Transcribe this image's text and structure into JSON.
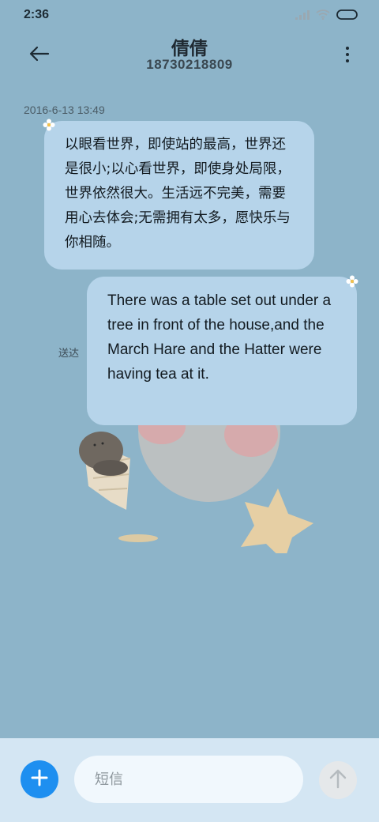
{
  "status_bar": {
    "time": "2:36",
    "icons": [
      "signal-icon",
      "wifi-icon",
      "battery-icon"
    ]
  },
  "header": {
    "contact_name": "倩倩",
    "contact_number": "18730218809",
    "back_icon": "arrow-left-icon",
    "more_icon": "more-vertical-icon"
  },
  "conversation": {
    "timestamp": "2016-6-13 13:49",
    "messages": [
      {
        "direction": "incoming",
        "text": "以眼看世界，即使站的最高，世界还是很小;以心看世界，即使身处局限，世界依然很大。生活远不完美，需要用心去体会;无需拥有太多，愿快乐与你相随。"
      },
      {
        "direction": "outgoing",
        "text": "There was a table set out under a tree in front of the house,and the March Hare and the Hatter were having tea at it."
      }
    ],
    "delivery_status": "送达"
  },
  "input_bar": {
    "placeholder": "短信",
    "value": "",
    "add_icon": "plus-icon",
    "send_icon": "arrow-up-icon"
  },
  "colors": {
    "background": "#8db4c9",
    "bubble": "#b6d4ea",
    "input_bar": "#d4e6f3",
    "accent": "#1e8ff0"
  }
}
